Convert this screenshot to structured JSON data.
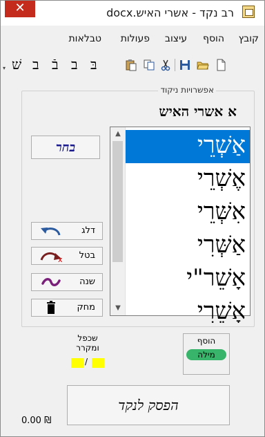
{
  "window": {
    "title": "רב נקד - אשרי האיש.docx",
    "close_glyph": "✕"
  },
  "menu": [
    {
      "id": "file",
      "label": "קובץ"
    },
    {
      "id": "add",
      "label": "הוסף"
    },
    {
      "id": "design",
      "label": "עיצוב"
    },
    {
      "id": "actions",
      "label": "פעולות"
    },
    {
      "id": "tables",
      "label": "טבלאות"
    }
  ],
  "toolbar": {
    "icons": [
      "new-document-icon",
      "open-folder-icon",
      "save-icon",
      "cut-icon",
      "copy-icon",
      "paste-icon"
    ],
    "letters": [
      "בּ",
      "ב",
      "בֿ",
      "ב",
      "שׁ"
    ]
  },
  "options_group": {
    "legend": "אפשרויות ניקוד",
    "word": "א אשרי האיש"
  },
  "word_list": {
    "items": [
      "אַשְׁרֵי",
      "אֶשְׁרֵי",
      "אִשְּׁרֵי",
      "אַשְּׁרִי",
      "אָשֵׁר\"י",
      "אָשֵׁרִי"
    ],
    "selected_index": 0
  },
  "buttons": {
    "choose": "בחר",
    "skip": "דלג",
    "cancel": "בטל",
    "change": "שנה",
    "delete": "מחק",
    "add_word_title": "הוסף",
    "add_word_sub": "מילה",
    "duplicate_title": "שכפל ומקרר",
    "duplicate_slash": "/",
    "stop": "הפסק לנקד"
  },
  "status": {
    "balance": "₪ 0.00"
  },
  "colors": {
    "selection": "#0078d7",
    "close": "#c42b1c",
    "add_word_badge": "#38b56a",
    "swatch": "#ffff00"
  }
}
